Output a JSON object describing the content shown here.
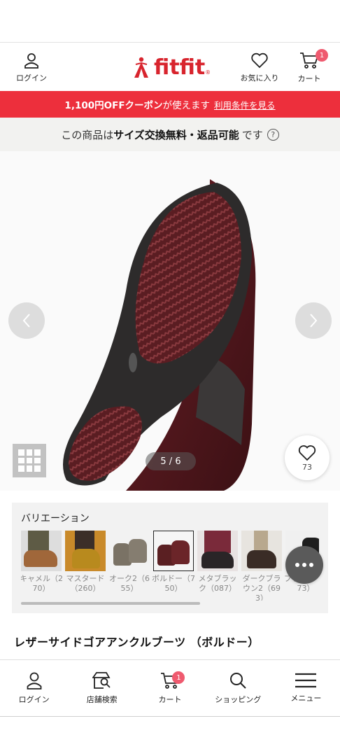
{
  "header": {
    "login_label": "ログイン",
    "logo_text": "fitfit",
    "logo_reg": "®",
    "favorites_label": "お気に入り",
    "cart_label": "カート",
    "cart_count": "1",
    "accent_color": "#d8242d"
  },
  "coupon": {
    "strong_text": "1,100円OFFクーポン",
    "text": "が使えます",
    "link_label": "利用条件を見る",
    "bg_color": "#ed2f3c"
  },
  "exchange": {
    "prefix": "この商品は",
    "strong_text": "サイズ交換無料・返品可能",
    "suffix": "です",
    "help_icon": "?"
  },
  "gallery": {
    "counter": "5 / 6",
    "like_count": "73",
    "prev_icon": "chevron-left-icon",
    "next_icon": "chevron-right-icon"
  },
  "variation": {
    "title": "バリエーション",
    "items": [
      {
        "name": "キャメル（270）",
        "color": "#a0673a",
        "selected": false
      },
      {
        "name": "マスタード（260）",
        "color": "#b88a1e",
        "selected": false
      },
      {
        "name": "オーク2（655）",
        "color": "#7a7265",
        "selected": false
      },
      {
        "name": "ボルドー（750）",
        "color": "#5a1f22",
        "selected": true
      },
      {
        "name": "メタブラック（087）",
        "color": "#2a2527",
        "selected": false
      },
      {
        "name": "ダークブラウン2（693）",
        "color": "#3a2c26",
        "selected": false
      },
      {
        "name": "ブラック（073）",
        "color": "#1e1e1e",
        "selected": false
      }
    ]
  },
  "product": {
    "title": "レザーサイドゴアアンクルブーツ （ボルドー）"
  },
  "bottom_nav": {
    "items": [
      {
        "label": "ログイン",
        "icon": "person-icon"
      },
      {
        "label": "店舗検索",
        "icon": "store-search-icon"
      },
      {
        "label": "カート",
        "icon": "cart-icon",
        "badge": "1"
      },
      {
        "label": "ショッピング",
        "icon": "search-icon"
      },
      {
        "label": "メニュー",
        "icon": "menu-icon"
      }
    ]
  }
}
